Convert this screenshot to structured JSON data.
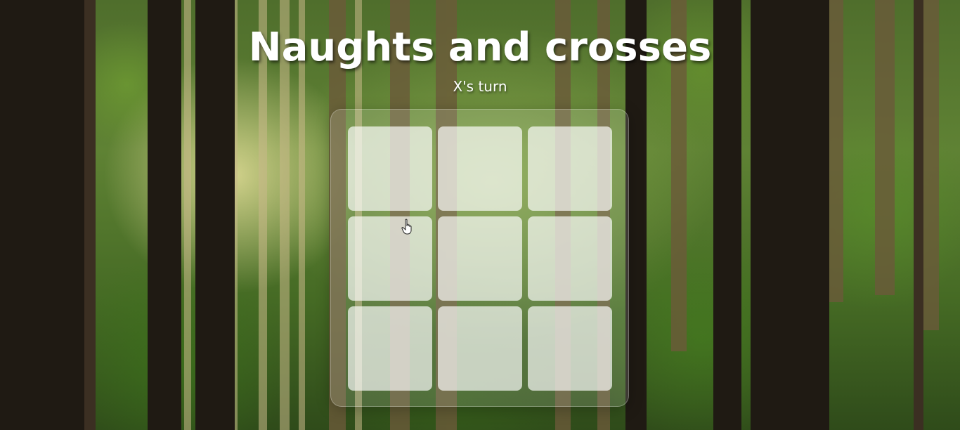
{
  "title": "Naughts and crosses",
  "status": "X's turn",
  "board": {
    "cells": [
      "",
      "",
      "",
      "",
      "",
      "",
      "",
      "",
      ""
    ]
  },
  "colors": {
    "text": "#ffffff",
    "cell_fill": "rgba(255,255,255,0.68)",
    "board_fill": "rgba(255,255,255,0.14)"
  },
  "background": "forest-photo",
  "cursor_icon": "hand-pointer-icon"
}
